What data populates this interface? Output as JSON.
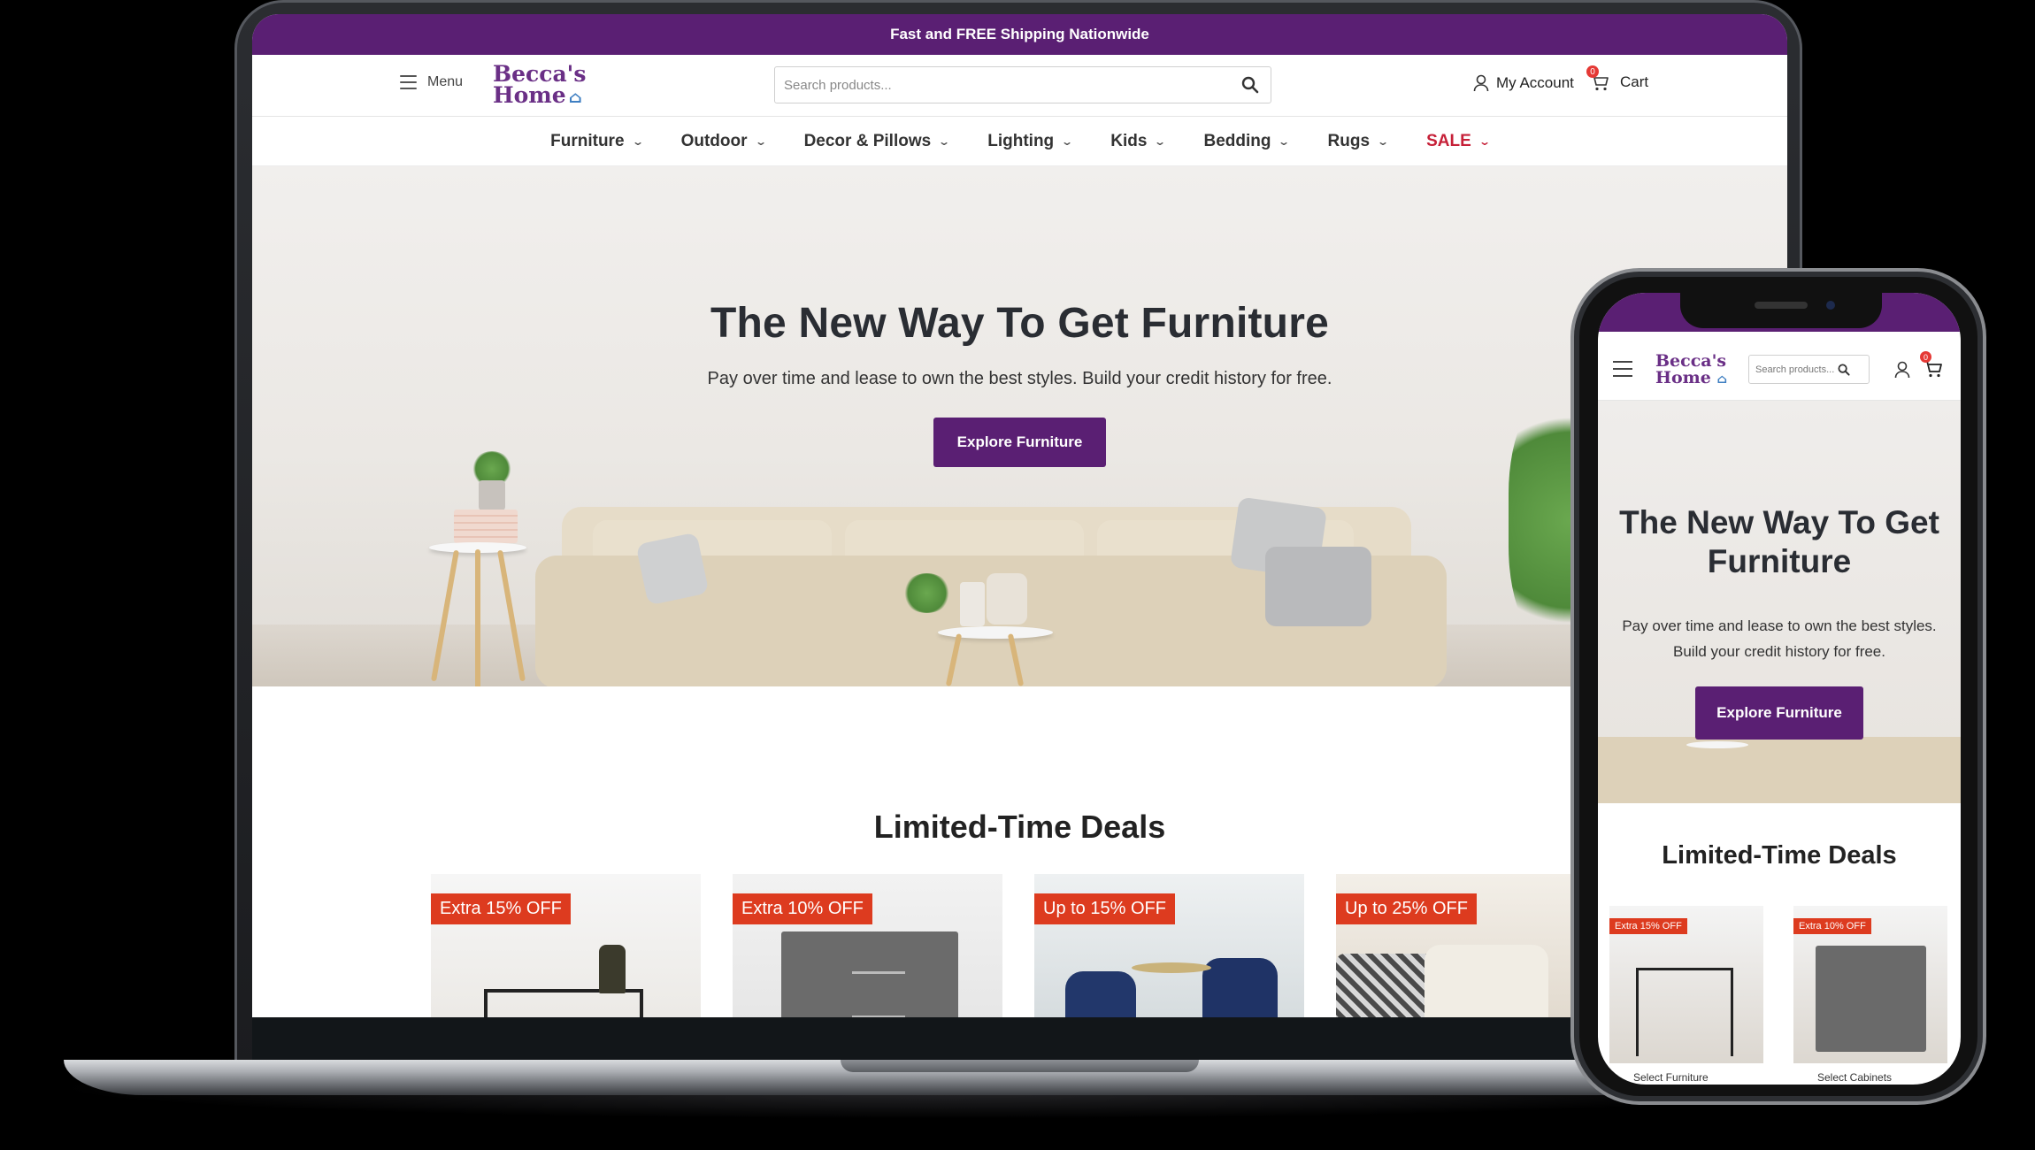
{
  "promo_bar": {
    "text": "Fast and FREE Shipping Nationwide"
  },
  "header": {
    "menu_label": "Menu",
    "logo_line1": "Becca's",
    "logo_line2": "Home",
    "search_placeholder": "Search products...",
    "account_label": "My Account",
    "cart_label": "Cart",
    "cart_count": "0"
  },
  "nav": {
    "items": [
      {
        "label": "Furniture"
      },
      {
        "label": "Outdoor"
      },
      {
        "label": "Decor & Pillows"
      },
      {
        "label": "Lighting"
      },
      {
        "label": "Kids"
      },
      {
        "label": "Bedding"
      },
      {
        "label": "Rugs"
      },
      {
        "label": "SALE"
      }
    ]
  },
  "hero": {
    "title": "The New Way To Get Furniture",
    "subtitle": "Pay over time and lease to own the best styles. Build your credit history for free.",
    "button_label": "Explore Furniture"
  },
  "deals": {
    "title": "Limited-Time Deals",
    "cards": [
      {
        "tag": "Extra 15% OFF"
      },
      {
        "tag": "Extra 10% OFF"
      },
      {
        "tag": "Up to 15% OFF"
      },
      {
        "tag": "Up to 25% OFF"
      }
    ]
  },
  "mobile": {
    "logo_line1": "Becca's",
    "logo_line2": "Home",
    "search_placeholder": "Search products...",
    "cart_count": "0",
    "hero_title": "The New Way To Get Furniture",
    "hero_subtitle": "Pay over time and lease to own the best styles. Build your credit history for free.",
    "hero_button": "Explore Furniture",
    "deals_title": "Limited-Time Deals",
    "cards": [
      {
        "tag": "Extra 15% OFF",
        "link": "Select Furniture"
      },
      {
        "tag": "Extra 10% OFF",
        "link": "Select Cabinets"
      }
    ]
  },
  "colors": {
    "brand_purple": "#5a1f73",
    "sale_red": "#c62038",
    "deal_tag_red": "#dd3b1f",
    "logo_house_blue": "#3f7fc2"
  },
  "icons": [
    "hamburger-icon",
    "search-icon",
    "user-icon",
    "cart-icon",
    "chevron-down-icon",
    "house-icon"
  ]
}
